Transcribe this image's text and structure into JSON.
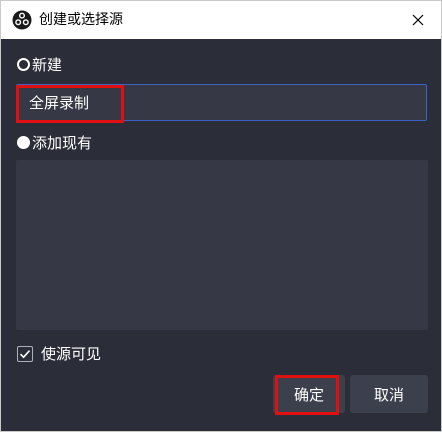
{
  "window": {
    "title": "创建或选择源",
    "app_icon": "obs-logo-icon",
    "close_icon": "close-icon"
  },
  "options": {
    "new_label": "新建",
    "existing_label": "添加现有",
    "selected": "new"
  },
  "name_input": {
    "value": "全屏录制"
  },
  "existing_sources": [],
  "visible_checkbox": {
    "label": "使源可见",
    "checked": true
  },
  "buttons": {
    "ok_label": "确定",
    "cancel_label": "取消"
  },
  "colors": {
    "background": "#2b2e38",
    "field": "#363945",
    "focus_border": "#3b63c7",
    "highlight": "#e01010"
  }
}
